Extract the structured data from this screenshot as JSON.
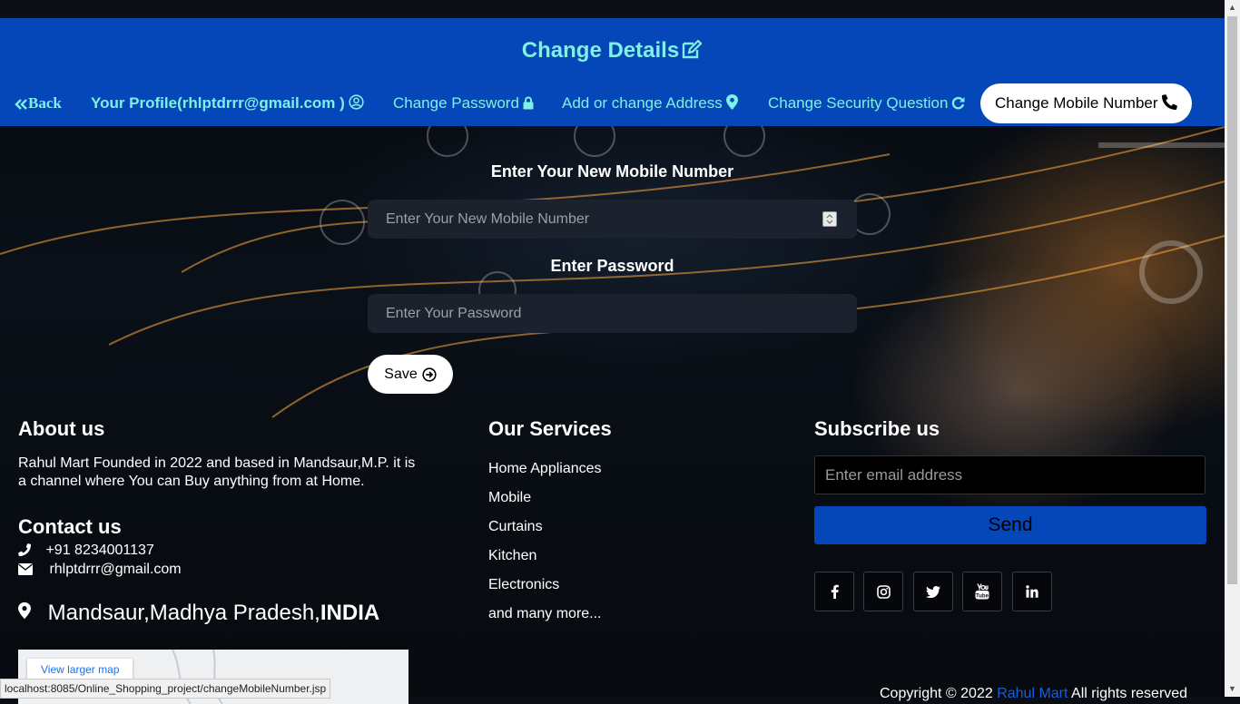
{
  "header": {
    "title": "Change Details",
    "nav": {
      "back": "Back",
      "profile": "Your Profile(rhlptdrrr@gmail.com )",
      "change_password": "Change Password",
      "address": "Add or change Address",
      "security_question": "Change Security Question",
      "mobile_number": "Change Mobile Number"
    }
  },
  "form": {
    "mobile_label": "Enter Your New Mobile Number",
    "mobile_placeholder": "Enter Your New Mobile Number",
    "password_label": "Enter Password",
    "password_placeholder": "Enter Your Password",
    "save_label": "Save"
  },
  "footer": {
    "about": {
      "heading": "About us",
      "text": "Rahul Mart Founded in 2022 and based in Mandsaur,M.P. it is a channel where You can Buy anything from at Home."
    },
    "contact": {
      "heading": "Contact us",
      "phone": "+91 8234001137",
      "email": "rhlptdrrr@gmail.com",
      "address_prefix": "Mandsaur,Madhya Pradesh,",
      "address_country": "INDIA"
    },
    "map": {
      "link_label": "View larger map"
    },
    "services": {
      "heading": "Our Services",
      "items": [
        "Home Appliances",
        "Mobile",
        "Curtains",
        "Kitchen",
        "Electronics",
        "and many more..."
      ]
    },
    "subscribe": {
      "heading": "Subscribe us",
      "email_placeholder": "Enter email address",
      "send_label": "Send"
    },
    "social": [
      "facebook-icon",
      "instagram-icon",
      "twitter-icon",
      "youtube-icon",
      "linkedin-icon"
    ],
    "copyright": {
      "prefix": "Copyright © 2022 ",
      "brand": "Rahul Mart",
      "suffix": " All rights reserved"
    }
  },
  "status_bar": {
    "url": "localhost:8085/Online_Shopping_project/changeMobileNumber.jsp"
  },
  "colors": {
    "header_bg": "#0546b8",
    "accent_text": "#7ff0e6",
    "send_button": "#0546b8"
  }
}
